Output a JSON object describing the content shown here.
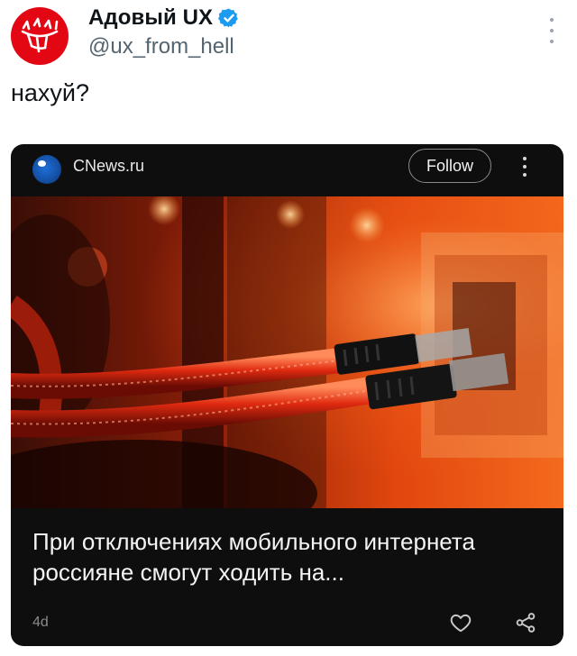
{
  "author": {
    "name": "Адовый UX",
    "handle": "@ux_from_hell",
    "avatar_icon": "devil-trident-logo",
    "verified": true
  },
  "tweet": {
    "text": "нахуй?"
  },
  "card": {
    "source_name": "CNews.ru",
    "follow_label": "Follow",
    "headline": "При отключениях мобильного интернета россияне смогут ходить на...",
    "age": "4d",
    "icons": {
      "like": "heart-icon",
      "share": "share-icon",
      "more": "more-vertical-icon"
    }
  },
  "colors": {
    "avatar_bg": "#e30613",
    "verified_badge": "#1d9bf0",
    "card_bg": "#0e0e0e"
  }
}
